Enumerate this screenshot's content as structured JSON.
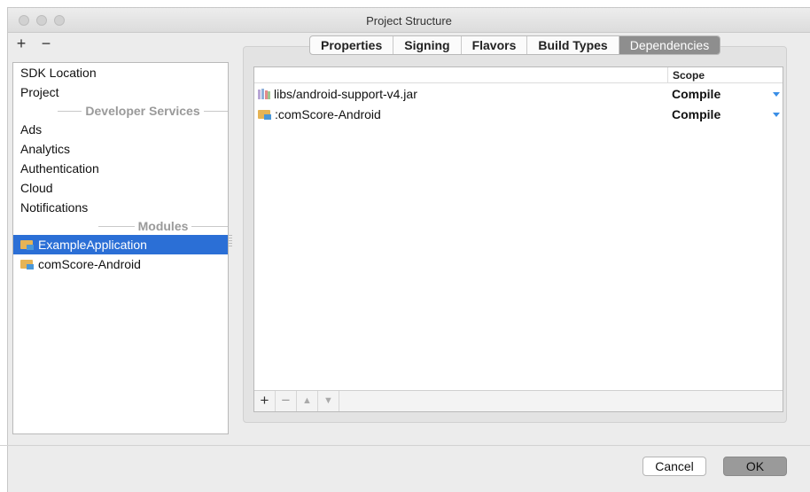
{
  "window": {
    "title": "Project Structure"
  },
  "left_toolbar": {
    "add": "+",
    "remove": "−"
  },
  "left_list": {
    "items_top": [
      "SDK Location",
      "Project"
    ],
    "section_developer": "Developer Services",
    "items_services": [
      "Ads",
      "Analytics",
      "Authentication",
      "Cloud",
      "Notifications"
    ],
    "section_modules": "Modules",
    "modules": [
      {
        "label": "ExampleApplication",
        "selected": true
      },
      {
        "label": "comScore-Android",
        "selected": false
      }
    ]
  },
  "tabs": [
    {
      "label": "Properties",
      "active": false
    },
    {
      "label": "Signing",
      "active": false
    },
    {
      "label": "Flavors",
      "active": false
    },
    {
      "label": "Build Types",
      "active": false
    },
    {
      "label": "Dependencies",
      "active": true
    }
  ],
  "dependencies": {
    "scope_header": "Scope",
    "rows": [
      {
        "name": "libs/android-support-v4.jar",
        "scope": "Compile",
        "icon": "jar-icon"
      },
      {
        "name": ":comScore-Android",
        "scope": "Compile",
        "icon": "module-folder-icon"
      }
    ],
    "toolbar": {
      "add": "+",
      "remove": "−",
      "up": "▲",
      "down": "▼"
    }
  },
  "buttons": {
    "cancel": "Cancel",
    "ok": "OK"
  },
  "colors": {
    "selection": "#2b6fd6",
    "active_tab": "#8e8e8e",
    "dropdown_arrow": "#3a8ee6"
  }
}
